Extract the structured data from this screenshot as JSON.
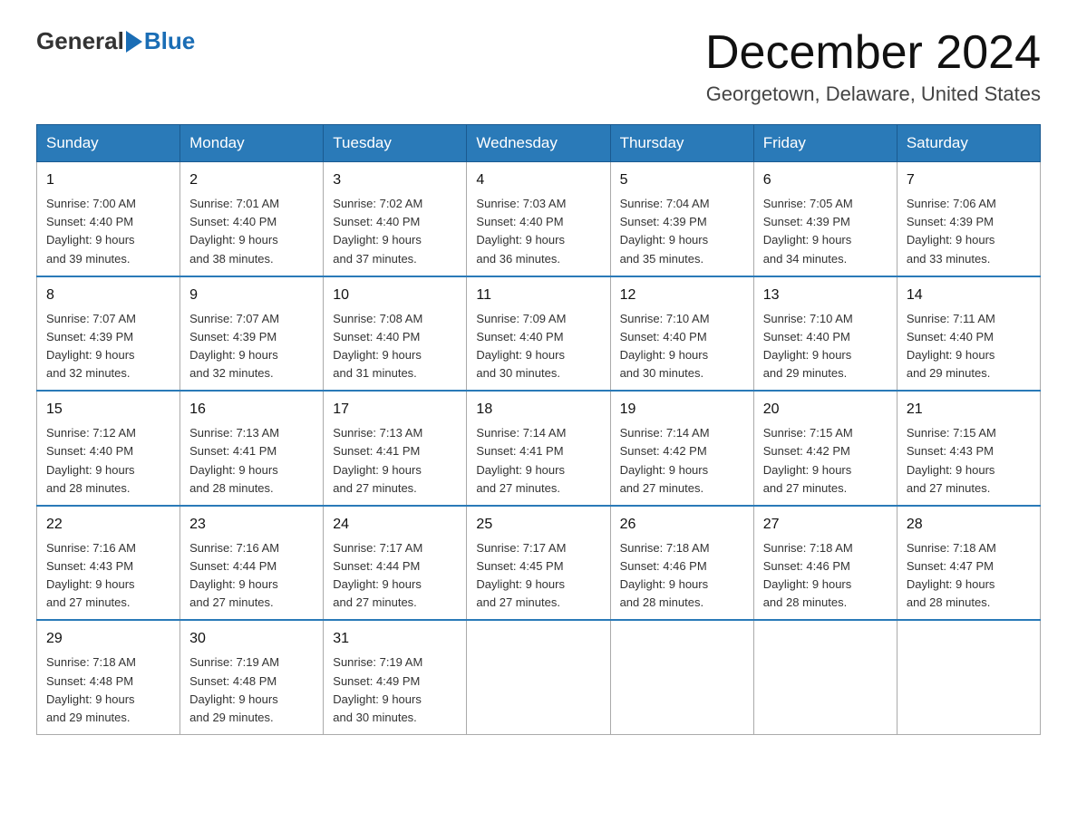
{
  "header": {
    "logo_general": "General",
    "logo_blue": "Blue",
    "month_title": "December 2024",
    "location": "Georgetown, Delaware, United States"
  },
  "weekdays": [
    "Sunday",
    "Monday",
    "Tuesday",
    "Wednesday",
    "Thursday",
    "Friday",
    "Saturday"
  ],
  "weeks": [
    [
      {
        "day": "1",
        "sunrise": "7:00 AM",
        "sunset": "4:40 PM",
        "daylight": "9 hours and 39 minutes."
      },
      {
        "day": "2",
        "sunrise": "7:01 AM",
        "sunset": "4:40 PM",
        "daylight": "9 hours and 38 minutes."
      },
      {
        "day": "3",
        "sunrise": "7:02 AM",
        "sunset": "4:40 PM",
        "daylight": "9 hours and 37 minutes."
      },
      {
        "day": "4",
        "sunrise": "7:03 AM",
        "sunset": "4:40 PM",
        "daylight": "9 hours and 36 minutes."
      },
      {
        "day": "5",
        "sunrise": "7:04 AM",
        "sunset": "4:39 PM",
        "daylight": "9 hours and 35 minutes."
      },
      {
        "day": "6",
        "sunrise": "7:05 AM",
        "sunset": "4:39 PM",
        "daylight": "9 hours and 34 minutes."
      },
      {
        "day": "7",
        "sunrise": "7:06 AM",
        "sunset": "4:39 PM",
        "daylight": "9 hours and 33 minutes."
      }
    ],
    [
      {
        "day": "8",
        "sunrise": "7:07 AM",
        "sunset": "4:39 PM",
        "daylight": "9 hours and 32 minutes."
      },
      {
        "day": "9",
        "sunrise": "7:07 AM",
        "sunset": "4:39 PM",
        "daylight": "9 hours and 32 minutes."
      },
      {
        "day": "10",
        "sunrise": "7:08 AM",
        "sunset": "4:40 PM",
        "daylight": "9 hours and 31 minutes."
      },
      {
        "day": "11",
        "sunrise": "7:09 AM",
        "sunset": "4:40 PM",
        "daylight": "9 hours and 30 minutes."
      },
      {
        "day": "12",
        "sunrise": "7:10 AM",
        "sunset": "4:40 PM",
        "daylight": "9 hours and 30 minutes."
      },
      {
        "day": "13",
        "sunrise": "7:10 AM",
        "sunset": "4:40 PM",
        "daylight": "9 hours and 29 minutes."
      },
      {
        "day": "14",
        "sunrise": "7:11 AM",
        "sunset": "4:40 PM",
        "daylight": "9 hours and 29 minutes."
      }
    ],
    [
      {
        "day": "15",
        "sunrise": "7:12 AM",
        "sunset": "4:40 PM",
        "daylight": "9 hours and 28 minutes."
      },
      {
        "day": "16",
        "sunrise": "7:13 AM",
        "sunset": "4:41 PM",
        "daylight": "9 hours and 28 minutes."
      },
      {
        "day": "17",
        "sunrise": "7:13 AM",
        "sunset": "4:41 PM",
        "daylight": "9 hours and 27 minutes."
      },
      {
        "day": "18",
        "sunrise": "7:14 AM",
        "sunset": "4:41 PM",
        "daylight": "9 hours and 27 minutes."
      },
      {
        "day": "19",
        "sunrise": "7:14 AM",
        "sunset": "4:42 PM",
        "daylight": "9 hours and 27 minutes."
      },
      {
        "day": "20",
        "sunrise": "7:15 AM",
        "sunset": "4:42 PM",
        "daylight": "9 hours and 27 minutes."
      },
      {
        "day": "21",
        "sunrise": "7:15 AM",
        "sunset": "4:43 PM",
        "daylight": "9 hours and 27 minutes."
      }
    ],
    [
      {
        "day": "22",
        "sunrise": "7:16 AM",
        "sunset": "4:43 PM",
        "daylight": "9 hours and 27 minutes."
      },
      {
        "day": "23",
        "sunrise": "7:16 AM",
        "sunset": "4:44 PM",
        "daylight": "9 hours and 27 minutes."
      },
      {
        "day": "24",
        "sunrise": "7:17 AM",
        "sunset": "4:44 PM",
        "daylight": "9 hours and 27 minutes."
      },
      {
        "day": "25",
        "sunrise": "7:17 AM",
        "sunset": "4:45 PM",
        "daylight": "9 hours and 27 minutes."
      },
      {
        "day": "26",
        "sunrise": "7:18 AM",
        "sunset": "4:46 PM",
        "daylight": "9 hours and 28 minutes."
      },
      {
        "day": "27",
        "sunrise": "7:18 AM",
        "sunset": "4:46 PM",
        "daylight": "9 hours and 28 minutes."
      },
      {
        "day": "28",
        "sunrise": "7:18 AM",
        "sunset": "4:47 PM",
        "daylight": "9 hours and 28 minutes."
      }
    ],
    [
      {
        "day": "29",
        "sunrise": "7:18 AM",
        "sunset": "4:48 PM",
        "daylight": "9 hours and 29 minutes."
      },
      {
        "day": "30",
        "sunrise": "7:19 AM",
        "sunset": "4:48 PM",
        "daylight": "9 hours and 29 minutes."
      },
      {
        "day": "31",
        "sunrise": "7:19 AM",
        "sunset": "4:49 PM",
        "daylight": "9 hours and 30 minutes."
      },
      null,
      null,
      null,
      null
    ]
  ],
  "labels": {
    "sunrise": "Sunrise:",
    "sunset": "Sunset:",
    "daylight": "Daylight:"
  }
}
